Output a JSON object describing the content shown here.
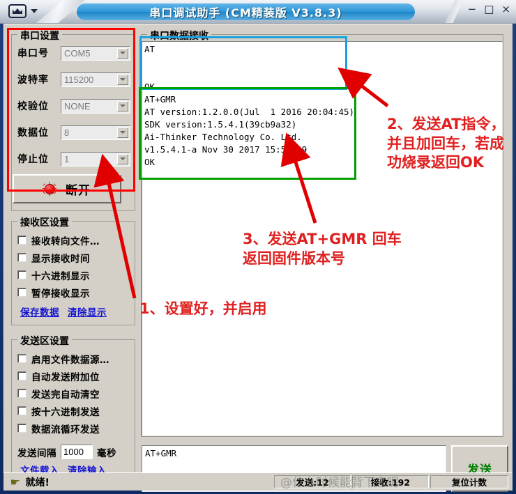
{
  "window": {
    "title": "串口调试助手 (CM精装版 V3.8.3)",
    "icon": "crown-icon",
    "dropdown_icon": "chevron-down-icon",
    "minimize_label": "−",
    "maximize_label": "□",
    "close_label": "×"
  },
  "serial_settings": {
    "group_title": "串口设置",
    "fields": [
      {
        "label": "串口号",
        "value": "COM5"
      },
      {
        "label": "波特率",
        "value": "115200"
      },
      {
        "label": "校验位",
        "value": "NONE"
      },
      {
        "label": "数据位",
        "value": "8"
      },
      {
        "label": "停止位",
        "value": "1"
      }
    ],
    "connect_button": "断开",
    "led_color": "#ef1010"
  },
  "recv_settings": {
    "group_title": "接收区设置",
    "checkboxes": [
      {
        "label": "接收转向文件…",
        "checked": false
      },
      {
        "label": "显示接收时间",
        "checked": false
      },
      {
        "label": "十六进制显示",
        "checked": false
      },
      {
        "label": "暂停接收显示",
        "checked": false
      }
    ],
    "links": [
      {
        "label": "保存数据"
      },
      {
        "label": "清除显示"
      }
    ]
  },
  "send_settings": {
    "group_title": "发送区设置",
    "checkboxes": [
      {
        "label": "启用文件数据源…",
        "checked": false
      },
      {
        "label": "自动发送附加位",
        "checked": false
      },
      {
        "label": "发送完自动清空",
        "checked": false
      },
      {
        "label": "按十六进制发送",
        "checked": false
      },
      {
        "label": "数据流循环发送",
        "checked": false
      }
    ],
    "interval": {
      "label": "发送间隔",
      "value": "1000",
      "unit": "毫秒"
    },
    "links": [
      {
        "label": "文件载入"
      },
      {
        "label": "清除输入"
      }
    ]
  },
  "data_area": {
    "group_title": "串口数据接收",
    "received_text": "AT\n\n\nOK\nAT+GMR\nAT version:1.2.0.0(Jul  1 2016 20:04:45)\nSDK version:1.5.4.1(39cb9a32)\nAi-Thinker Technology Co. Ltd.\nv1.5.4.1-a Nov 30 2017 15:54:29\nOK"
  },
  "send_area": {
    "input_value": "AT+GMR",
    "send_button": "发送",
    "send_button_color": "#008000"
  },
  "statusbar": {
    "ready_icon": "pointing-hand-icon",
    "ready_text": "就绪!",
    "sent_counter": "发送:12",
    "recv_counter": "接收:192",
    "mode_text": "复位计数"
  },
  "annotations": {
    "accent_red": "#e02020",
    "box_blue": "#1ba1e2",
    "box_green": "#00a000",
    "note1": "1、设置好，并启用",
    "note2": "2、发送AT指令，并且加回车，若成功烧录返回OK",
    "note3": "3、发送AT+GMR 回车\n返回固件版本号"
  },
  "watermark": {
    "text": "@什么时候能背下来呢"
  }
}
